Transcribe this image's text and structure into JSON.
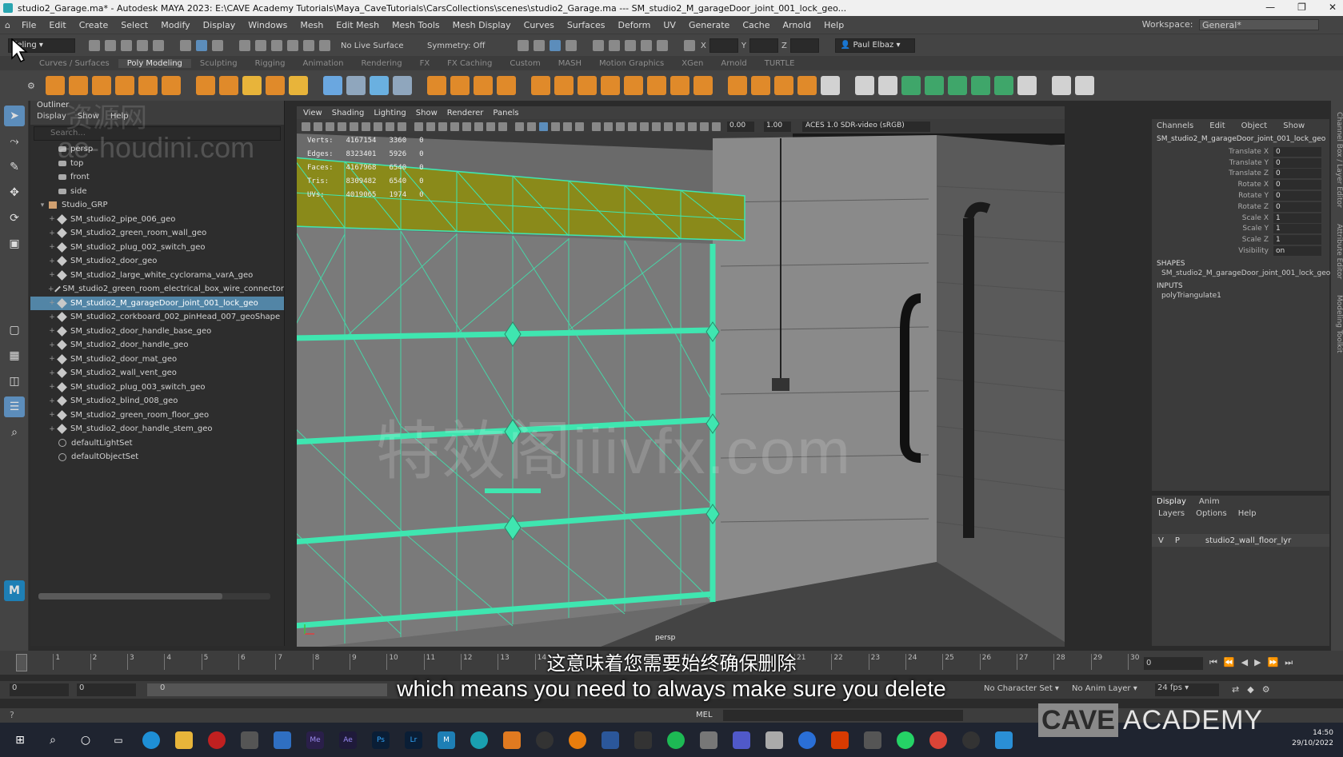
{
  "window": {
    "title": "studio2_Garage.ma* - Autodesk MAYA 2023: E:\\CAVE Academy Tutorials\\Maya_CaveTutorials\\CarsCollections\\scenes\\studio2_Garage.ma  ---  SM_studio2_M_garageDoor_joint_001_lock_geo...",
    "controls": [
      "—",
      "❐",
      "✕"
    ]
  },
  "menubar": {
    "items": [
      "File",
      "Edit",
      "Create",
      "Select",
      "Modify",
      "Display",
      "Windows",
      "Mesh",
      "Edit Mesh",
      "Mesh Tools",
      "Mesh Display",
      "Curves",
      "Surfaces",
      "Deform",
      "UV",
      "Generate",
      "Cache",
      "Arnold",
      "Help"
    ],
    "workspace_label": "Workspace:",
    "workspace_value": "General*"
  },
  "statusline": {
    "mode": "deling",
    "live_surface": "No Live Surface",
    "symmetry": "Symmetry: Off",
    "x_label": "X",
    "y_label": "Y",
    "z_label": "Z",
    "user": "Paul Elbaz"
  },
  "shelf_tabs": [
    "Curves / Surfaces",
    "Poly Modeling",
    "Sculpting",
    "Rigging",
    "Animation",
    "Rendering",
    "FX",
    "FX Caching",
    "Custom",
    "MASH",
    "Motion Graphics",
    "XGen",
    "Arnold",
    "TURTLE"
  ],
  "shelf_active": "Poly Modeling",
  "shelf_icon_colors": [
    "#e08a2a",
    "#e08a2a",
    "#e08a2a",
    "#e08a2a",
    "#e08a2a",
    "#e08a2a",
    "#e08a2a",
    "#e08a2a",
    "#e8b43a",
    "#e08a2a",
    "#e8b43a",
    "#6aa7e0",
    "#8fa6bd",
    "#6ab0e0",
    "#8fa6bd",
    "#e08a2a",
    "#e08a2a",
    "#e08a2a",
    "#e08a2a",
    "#e08a2a",
    "#e08a2a",
    "#e08a2a",
    "#e08a2a",
    "#e08a2a",
    "#e08a2a",
    "#e08a2a",
    "#e08a2a",
    "#e08a2a",
    "#e08a2a",
    "#e08a2a",
    "#e08a2a",
    "#d2d2d2",
    "#d2d2d2",
    "#d2d2d2",
    "#3fa66a",
    "#3fa66a",
    "#3fa66a",
    "#3fa66a",
    "#3fa66a",
    "#d2d2d2",
    "#d2d2d2",
    "#d2d2d2"
  ],
  "outliner": {
    "title": "Outliner",
    "menu": [
      "Display",
      "Show",
      "Help"
    ],
    "search_placeholder": "Search...",
    "cameras": [
      "persp",
      "top",
      "front",
      "side"
    ],
    "group": "Studio_GRP",
    "items": [
      "SM_studio2_pipe_006_geo",
      "SM_studio2_green_room_wall_geo",
      "SM_studio2_plug_002_switch_geo",
      "SM_studio2_door_geo",
      "SM_studio2_large_white_cyclorama_varA_geo",
      "SM_studio2_green_room_electrical_box_wire_connector",
      "SM_studio2_M_garageDoor_joint_001_lock_geo",
      "SM_studio2_corkboard_002_pinHead_007_geoShape",
      "SM_studio2_door_handle_base_geo",
      "SM_studio2_door_handle_geo",
      "SM_studio2_door_mat_geo",
      "SM_studio2_wall_vent_geo",
      "SM_studio2_plug_003_switch_geo",
      "SM_studio2_blind_008_geo",
      "SM_studio2_green_room_floor_geo",
      "SM_studio2_door_handle_stem_geo"
    ],
    "selected_index": 6,
    "sets": [
      "defaultLightSet",
      "defaultObjectSet"
    ]
  },
  "viewport": {
    "menu": [
      "View",
      "Shading",
      "Lighting",
      "Show",
      "Renderer",
      "Panels"
    ],
    "exposure": "0.00",
    "gamma": "1.00",
    "colorspace": "ACES 1.0 SDR-video (sRGB)",
    "camera_label": "persp",
    "hud": [
      {
        "label": "Verts:",
        "total": "4167154",
        "selected": "3360",
        "comp": "0"
      },
      {
        "label": "Edges:",
        "total": "8323401",
        "selected": "5926",
        "comp": "0"
      },
      {
        "label": "Faces:",
        "total": "4167968",
        "selected": "6540",
        "comp": "0"
      },
      {
        "label": "Tris:",
        "total": "8309482",
        "selected": "6540",
        "comp": "0"
      },
      {
        "label": "UVs:",
        "total": "4019065",
        "selected": "1974",
        "comp": "0"
      }
    ]
  },
  "channelbox": {
    "menu": [
      "Channels",
      "Edit",
      "Object",
      "Show"
    ],
    "object": "SM_studio2_M_garageDoor_joint_001_lock_geo",
    "attributes": [
      {
        "name": "Translate X",
        "value": "0"
      },
      {
        "name": "Translate Y",
        "value": "0"
      },
      {
        "name": "Translate Z",
        "value": "0"
      },
      {
        "name": "Rotate X",
        "value": "0"
      },
      {
        "name": "Rotate Y",
        "value": "0"
      },
      {
        "name": "Rotate Z",
        "value": "0"
      },
      {
        "name": "Scale X",
        "value": "1"
      },
      {
        "name": "Scale Y",
        "value": "1"
      },
      {
        "name": "Scale Z",
        "value": "1"
      },
      {
        "name": "Visibility",
        "value": "on"
      }
    ],
    "shapes_label": "SHAPES",
    "shape_name": "SM_studio2_M_garageDoor_joint_001_lock_geo...",
    "inputs_label": "INPUTS",
    "input_name": "polyTriangulate1"
  },
  "layer_editor": {
    "tabs": [
      "Display",
      "Anim"
    ],
    "menu": [
      "Layers",
      "Options",
      "Help"
    ],
    "layer": {
      "v": "V",
      "p": "P",
      "name": "studio2_wall_floor_lyr"
    }
  },
  "right_tabs": [
    "Channel Box / Layer Editor",
    "Attribute Editor",
    "Modeling Toolkit"
  ],
  "timeline": {
    "ticks": [
      "0",
      "1",
      "2",
      "3",
      "4",
      "5",
      "6",
      "7",
      "8",
      "9",
      "10",
      "11",
      "12",
      "13",
      "14",
      "15",
      "16",
      "17",
      "18",
      "19",
      "20",
      "21",
      "22",
      "23",
      "24",
      "25",
      "26",
      "27",
      "28",
      "29",
      "30"
    ],
    "current_frame": "0",
    "range_start": "0",
    "range_inner_start": "0",
    "range_slider_value": "0",
    "no_character_set": "No Character Set",
    "no_anim_layer": "No Anim Layer",
    "fps": "24 fps"
  },
  "cmdline": {
    "label": "MEL"
  },
  "subtitles": {
    "cn": "这意味着您需要始终确保删除",
    "en": "which means you need to always make sure you delete"
  },
  "watermarks": [
    "资源网",
    "ae-houdini.com",
    "特效阁iiivfx.com"
  ],
  "brand": {
    "left": "CAVE",
    "right": "ACADEMY"
  },
  "taskbar": {
    "apps": [
      "Me",
      "Ae",
      "Ps",
      "Lr",
      "M"
    ],
    "time": "14:50",
    "date": "29/10/2022"
  },
  "colors": {
    "selection_wire": "#3fe6b0",
    "header_face": "#8a8a1a",
    "outliner_selected": "#5285a6",
    "accent": "#5c8dbb"
  }
}
